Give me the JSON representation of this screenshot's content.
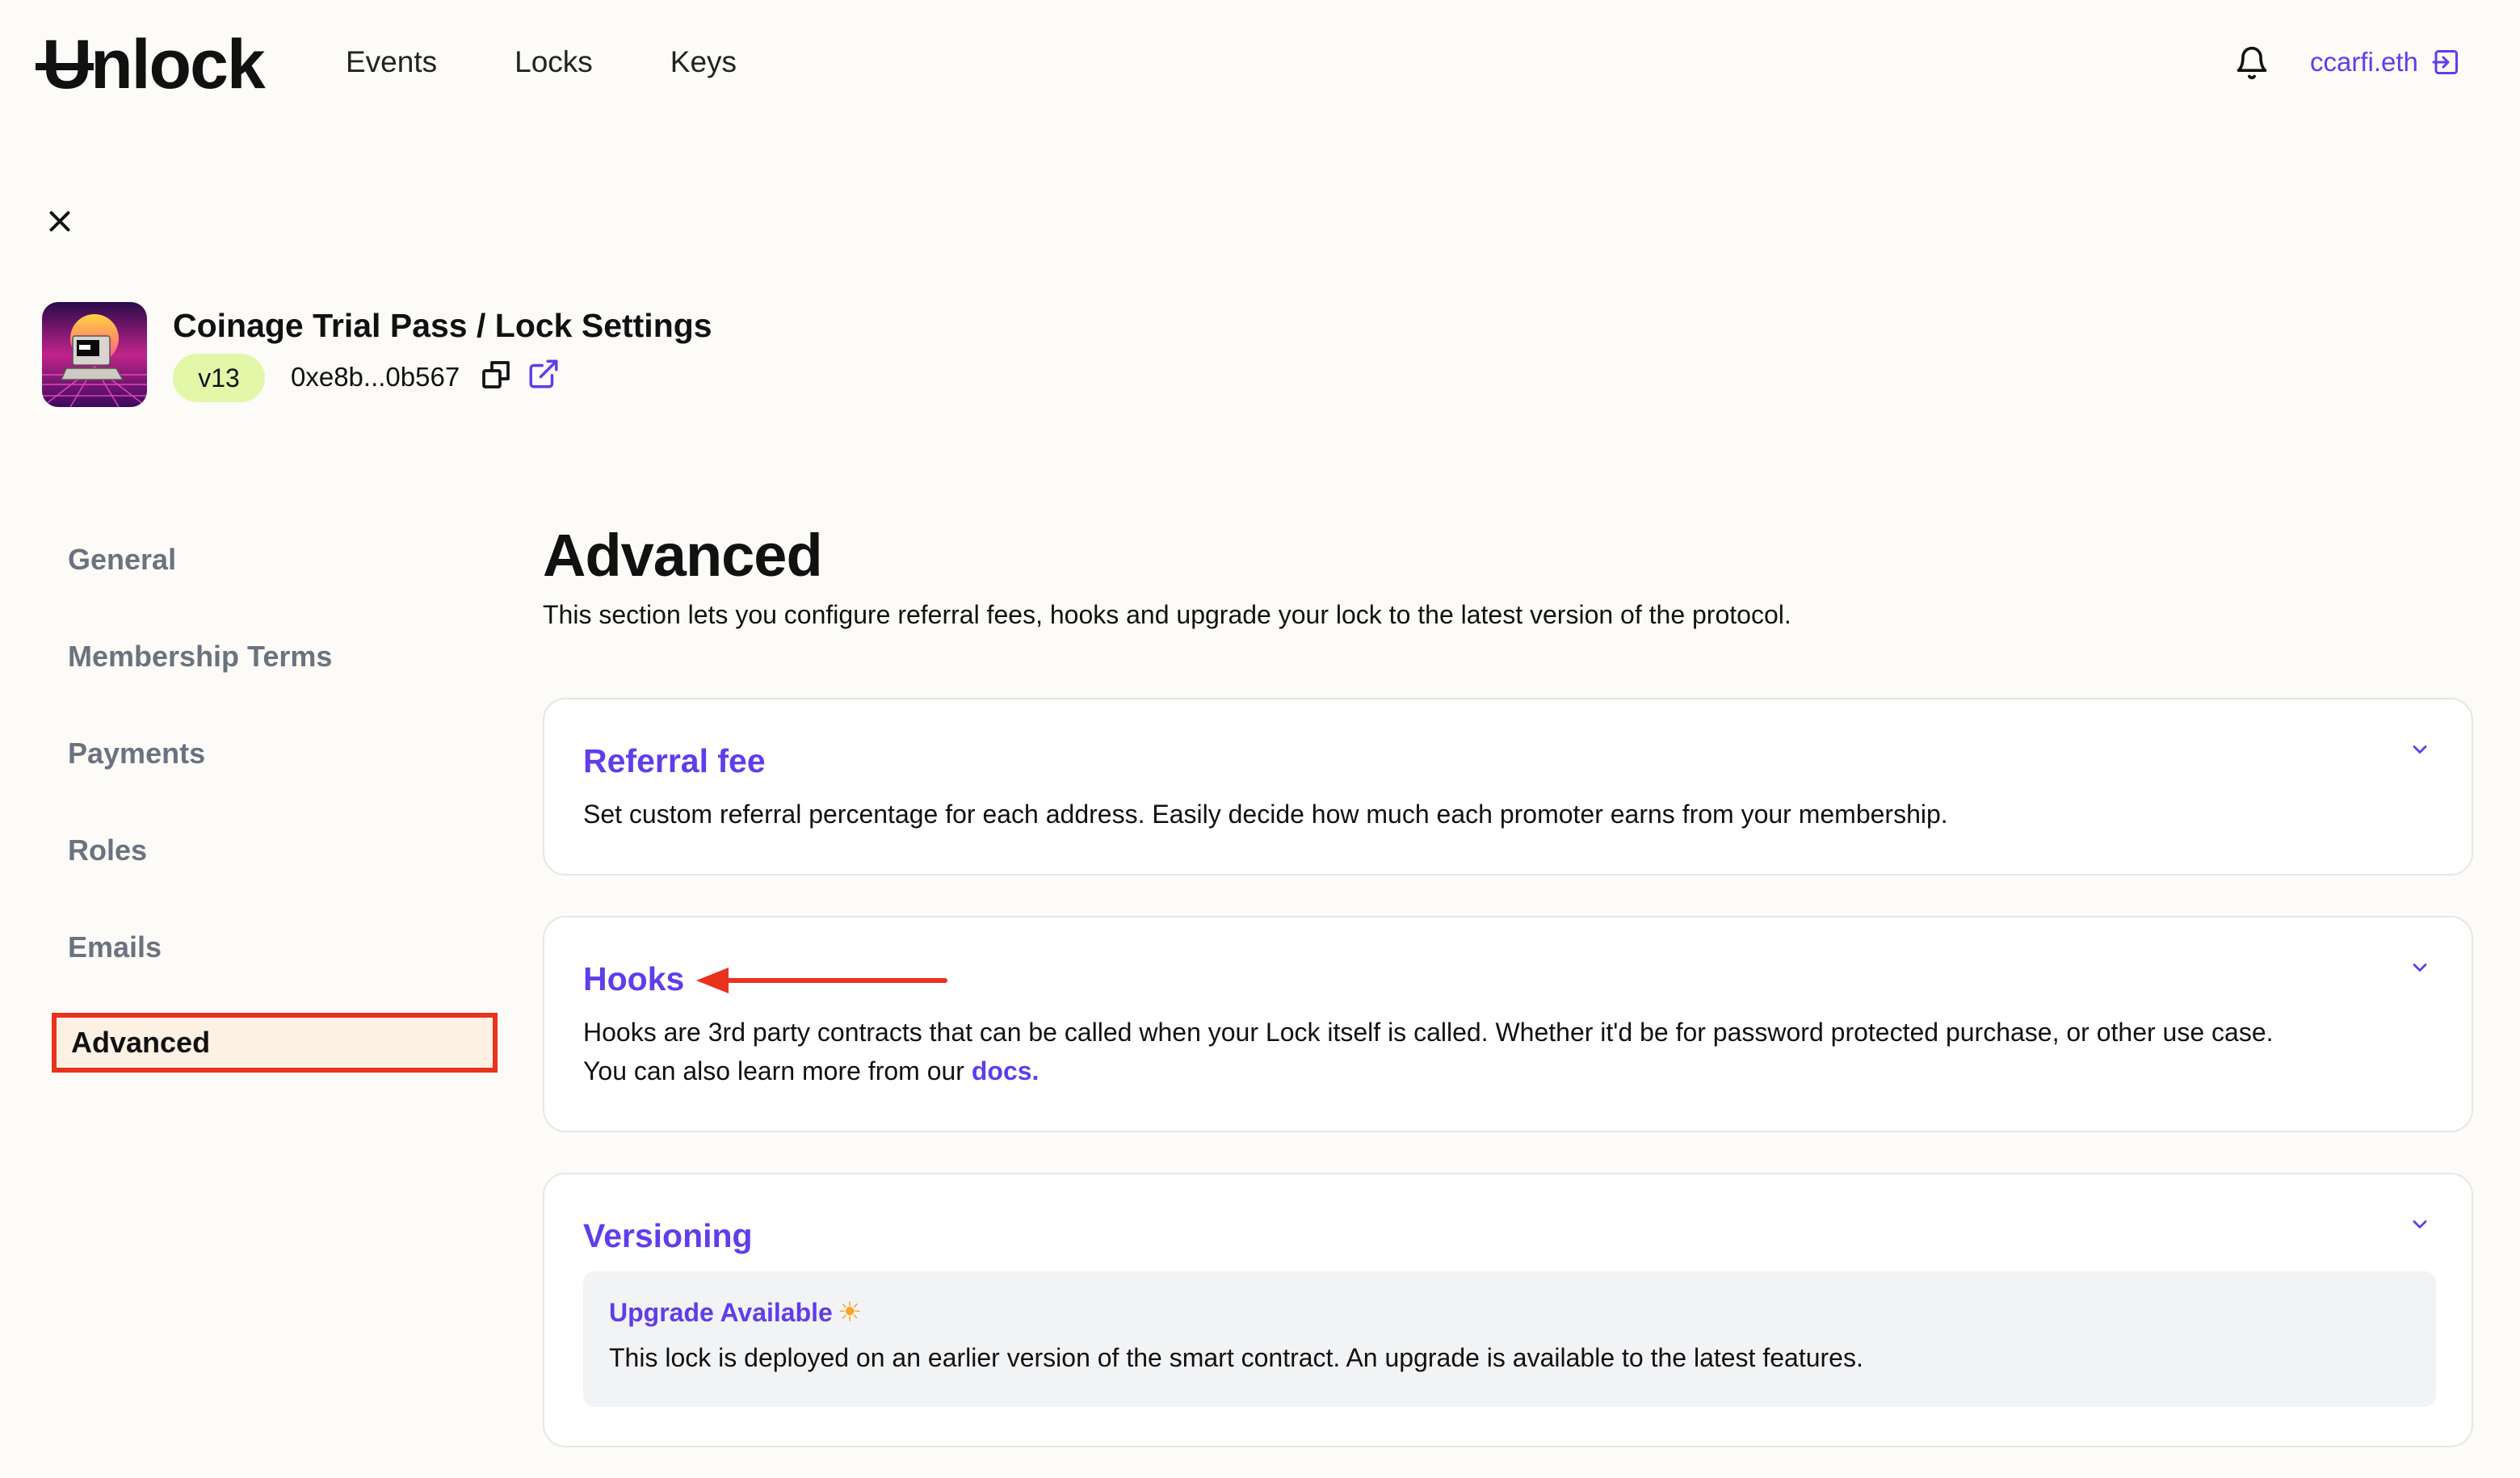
{
  "header": {
    "logo": "Unlock",
    "nav": [
      "Events",
      "Locks",
      "Keys"
    ],
    "user": "ccarfi.eth",
    "icons": {
      "bell": "bell-icon",
      "logout": "logout-icon"
    }
  },
  "lock": {
    "title": "Coinage Trial Pass / Lock Settings",
    "version": "v13",
    "address": "0xe8b...0b567"
  },
  "sidebar": {
    "items": [
      "General",
      "Membership Terms",
      "Payments",
      "Roles",
      "Emails"
    ],
    "active": "Advanced"
  },
  "main": {
    "title": "Advanced",
    "description": "This section lets you configure referral fees, hooks and upgrade your lock to the latest version of the protocol.",
    "cards": {
      "referral": {
        "title": "Referral fee",
        "text": "Set custom referral percentage for each address. Easily decide how much each promoter earns from your membership."
      },
      "hooks": {
        "title": "Hooks",
        "text1": "Hooks are 3rd party contracts that can be called when your Lock itself is called. Whether it'd be for password protected purchase, or other use case.",
        "text2": "You can also learn more from our ",
        "link": "docs."
      },
      "versioning": {
        "title": "Versioning",
        "upgrade_title": "Upgrade Available",
        "upgrade_text": "This lock is deployed on an earlier version of the smart contract. An upgrade is available to the latest features."
      }
    }
  },
  "colors": {
    "accent": "#603deb",
    "highlight": "#e8321e",
    "badge": "#e3f7a8",
    "background": "#fcfbf7"
  }
}
